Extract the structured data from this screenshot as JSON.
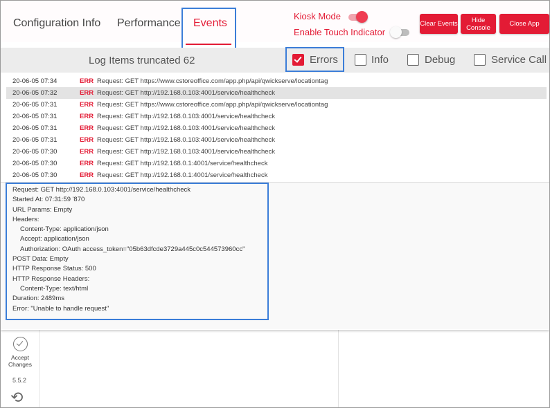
{
  "tabs": [
    "Configuration Info",
    "Performance",
    "Events"
  ],
  "kiosk": {
    "label": "Kiosk Mode",
    "on": true
  },
  "touch": {
    "label": "Enable Touch Indicator",
    "on": false
  },
  "buttons": {
    "clear": "Clear Events",
    "hide": "Hide Console",
    "close": "Close App"
  },
  "truncated_label": "Log Items truncated 62",
  "filters": [
    {
      "label": "Errors",
      "checked": true
    },
    {
      "label": "Info",
      "checked": false
    },
    {
      "label": "Debug",
      "checked": false
    },
    {
      "label": "Service Call",
      "checked": false
    }
  ],
  "log": [
    {
      "ts": "20-06-05 07:34",
      "level": "ERR",
      "msg": "Request: GET https://www.cstoreoffice.com/app.php/api/qwickserve/locationtag"
    },
    {
      "ts": "20-06-05 07:32",
      "level": "ERR",
      "msg": "Request: GET http://192.168.0.103:4001/service/healthcheck",
      "selected": true
    },
    {
      "ts": "20-06-05 07:31",
      "level": "ERR",
      "msg": "Request: GET https://www.cstoreoffice.com/app.php/api/qwickserve/locationtag"
    },
    {
      "ts": "20-06-05 07:31",
      "level": "ERR",
      "msg": "Request: GET http://192.168.0.103:4001/service/healthcheck"
    },
    {
      "ts": "20-06-05 07:31",
      "level": "ERR",
      "msg": "Request: GET http://192.168.0.103:4001/service/healthcheck"
    },
    {
      "ts": "20-06-05 07:31",
      "level": "ERR",
      "msg": "Request: GET http://192.168.0.103:4001/service/healthcheck"
    },
    {
      "ts": "20-06-05 07:30",
      "level": "ERR",
      "msg": "Request: GET http://192.168.0.103:4001/service/healthcheck"
    },
    {
      "ts": "20-06-05 07:30",
      "level": "ERR",
      "msg": "Request: GET http://192.168.0.1:4001/service/healthcheck"
    },
    {
      "ts": "20-06-05 07:30",
      "level": "ERR",
      "msg": "Request: GET http://192.168.0.1:4001/service/healthcheck"
    }
  ],
  "detail": [
    "Request: GET http://192.168.0.103:4001/service/healthcheck",
    "Started At: 07:31:59 '870",
    "URL Params: Empty",
    "Headers:",
    "Content-Type: application/json",
    "Accept: application/json",
    "Authorization: OAuth access_token=\"05b63dfcde3729a445c0c544573960cc\"",
    "POST Data: Empty",
    "HTTP Response Status: 500",
    "HTTP Response Headers:",
    "Content-Type: text/html",
    "Duration: 2489ms",
    "Error: \"Unable to handle request\""
  ],
  "sidebar": {
    "accept_label": "Accept Changes",
    "version": "5.5.2"
  },
  "colors": {
    "accent": "#e31b35",
    "highlight": "#3b7dd8"
  }
}
